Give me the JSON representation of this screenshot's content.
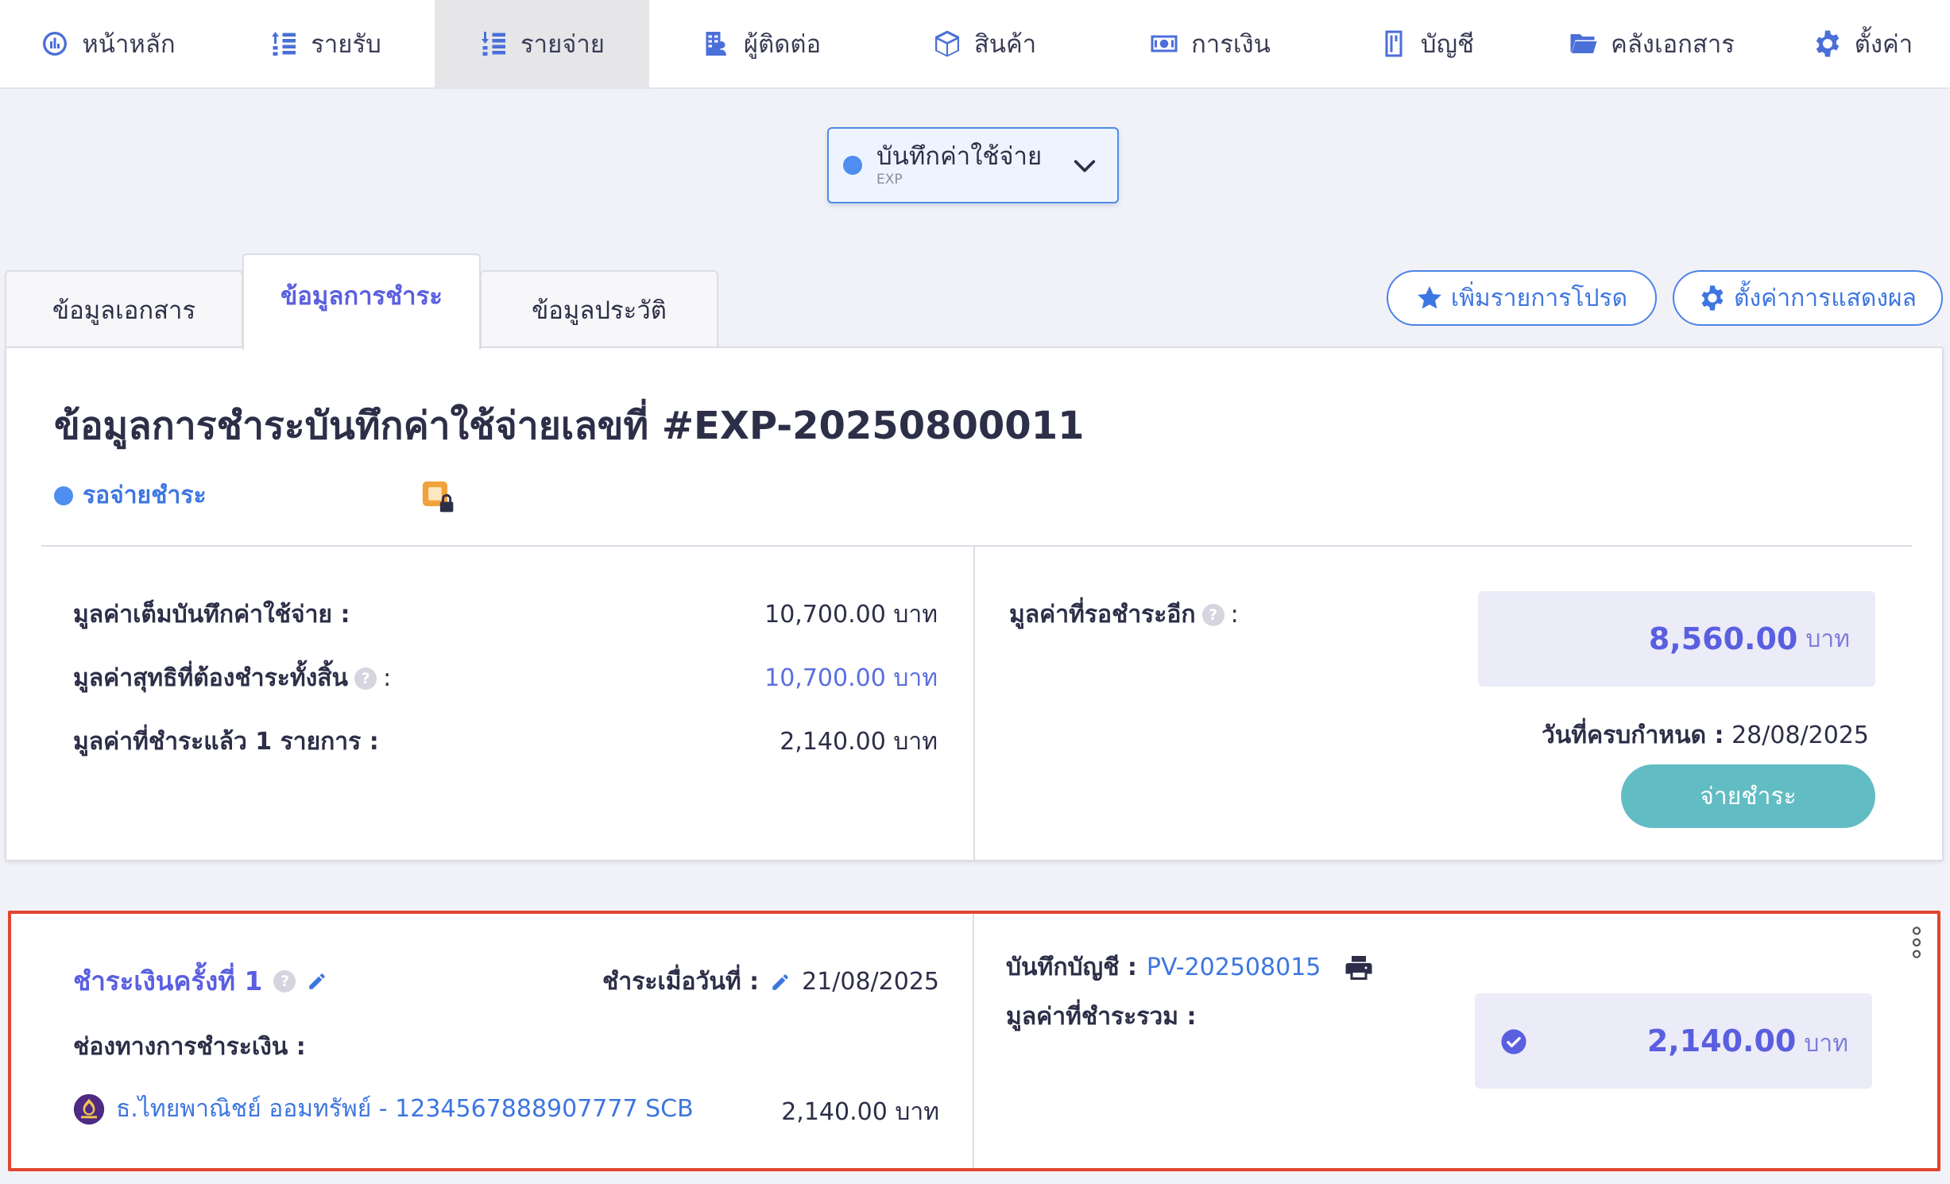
{
  "nav": {
    "items": [
      {
        "label": "หน้าหลัก",
        "icon": "dashboard-icon"
      },
      {
        "label": "รายรับ",
        "icon": "income-icon"
      },
      {
        "label": "รายจ่าย",
        "icon": "expense-icon",
        "active": true
      },
      {
        "label": "ผู้ติดต่อ",
        "icon": "contacts-icon"
      },
      {
        "label": "สินค้า",
        "icon": "box-icon"
      },
      {
        "label": "การเงิน",
        "icon": "money-icon"
      },
      {
        "label": "บัญชี",
        "icon": "ledger-icon"
      },
      {
        "label": "คลังเอกสาร",
        "icon": "folder-icon"
      },
      {
        "label": "ตั้งค่า",
        "icon": "gear-icon"
      }
    ]
  },
  "doc_type": {
    "label": "บันทึกค่าใช้จ่าย",
    "code": "EXP"
  },
  "tabs": [
    {
      "label": "ข้อมูลเอกสาร"
    },
    {
      "label": "ข้อมูลการชำระ",
      "active": true
    },
    {
      "label": "ข้อมูลประวัติ"
    }
  ],
  "actions": {
    "favorite": "เพิ่มรายการโปรด",
    "display_settings": "ตั้งค่าการแสดงผล"
  },
  "summary": {
    "title": "ข้อมูลการชำระบันทึกค่าใช้จ่ายเลขที่ #EXP-20250800011",
    "status": "รอจ่ายชำระ",
    "full_value_label": "มูลค่าเต็มบันทึกค่าใช้จ่าย :",
    "full_value": "10,700.00 บาท",
    "net_value_label": "มูลค่าสุทธิที่ต้องชำระทั้งสิ้น",
    "net_value": "10,700.00 บาท",
    "paid_label": "มูลค่าที่ชำระแล้ว 1 รายการ :",
    "paid_value": "2,140.00 บาท",
    "remaining_label": "มูลค่าที่รอชำระอีก",
    "remaining_value": "8,560.00",
    "currency": "บาท",
    "due_label": "วันที่ครบกำหนด :",
    "due_date": "28/08/2025",
    "pay_button": "จ่ายชำระ",
    "help_glyph": "?",
    "colon": ":"
  },
  "payment": {
    "title": "ชำระเงินครั้งที่ 1",
    "paid_on_label": "ชำระเมื่อวันที่ :",
    "paid_on": "21/08/2025",
    "channel_label": "ช่องทางการชำระเงิน :",
    "bank": "ธ.ไทยพาณิชย์ ออมทรัพย์ - 1234567888907777 SCB",
    "bank_amount": "2,140.00 บาท",
    "journal_label": "บันทึกบัญชี :",
    "journal_no": "PV-202508015",
    "total_label": "มูลค่าที่ชำระรวม :",
    "total": "2,140.00",
    "currency": "บาท"
  },
  "colors": {
    "accent": "#5a5fe0",
    "link": "#3d76e0",
    "highlight_border": "#e0452f",
    "pay_button": "#62bcc4"
  }
}
